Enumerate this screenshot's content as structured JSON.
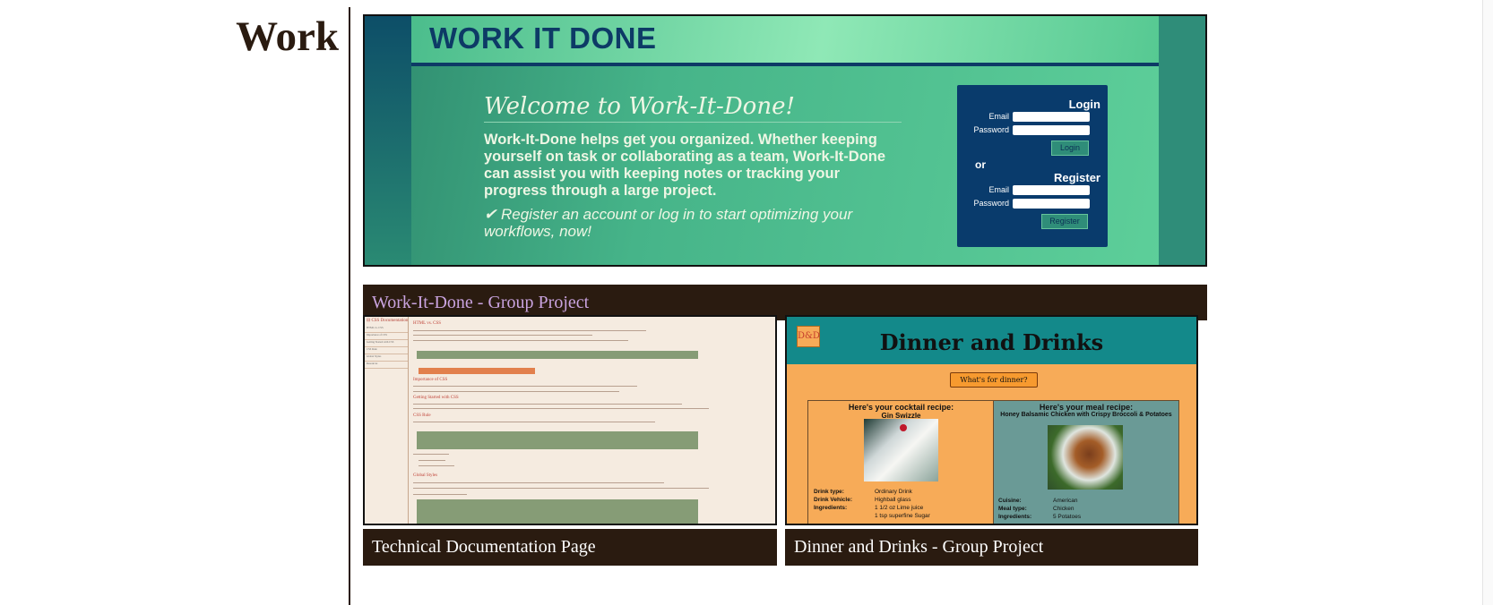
{
  "section": {
    "title": "Work"
  },
  "projects": [
    {
      "caption": "Work-It-Done - Group Project",
      "visited": true,
      "screenshot": {
        "brand": "WORK IT DONE",
        "welcome": "Welcome to Work-It-Done!",
        "description": "Work-It-Done helps get you organized. Whether keeping yourself on task or collaborating as a team, Work-It-Done can assist you with keeping notes or tracking your progress through a large project.",
        "cta": "✔ Register an account or log in to start optimizing your workflows, now!",
        "login_heading": "Login",
        "email_label": "Email",
        "password_label": "Password",
        "login_button": "Login",
        "or": "or",
        "register_heading": "Register",
        "register_button": "Register"
      }
    },
    {
      "caption": "Technical Documentation Page",
      "visited": false,
      "screenshot": {
        "nav_title": "⊟ CSS Documentation",
        "nav_items": [
          "HTML vs. CSS",
          "Importance of CSS",
          "Getting Started with CSS",
          "CSS Rule",
          "Global Styles",
          "Resources"
        ],
        "headings": [
          "HTML vs. CSS",
          "Importance of CSS",
          "Getting Started with CSS",
          "CSS Rule",
          "Global Styles"
        ]
      }
    },
    {
      "caption": "Dinner and Drinks - Group Project",
      "visited": false,
      "screenshot": {
        "logo": "D&D",
        "title": "Dinner and Drinks",
        "button": "What's for dinner?",
        "cocktail_heading": "Here's your cocktail recipe:",
        "cocktail_name": "Gin Swizzle",
        "drink_type_label": "Drink type:",
        "drink_type": "Ordinary Drink",
        "drink_vehicle_label": "Drink Vehicle:",
        "drink_vehicle": "Highball glass",
        "ingredients_label": "Ingredients:",
        "ingredient_1": "1 1/2 oz Lime juice",
        "ingredient_2": "1 tsp superfine Sugar",
        "meal_heading": "Here's your meal recipe:",
        "meal_name": "Honey Balsamic Chicken with Crispy Broccoli & Potatoes",
        "cuisine_label": "Cuisine:",
        "cuisine": "American",
        "meal_type_label": "Meal type:",
        "meal_type": "Chicken",
        "meal_ingredients_label": "Ingredients:",
        "meal_ingredient_1": "5 Potatoes"
      }
    }
  ],
  "colors": {
    "caption_bg": "#2a1b10",
    "visited_link": "#c9a3df",
    "text": "#2a1b10"
  }
}
